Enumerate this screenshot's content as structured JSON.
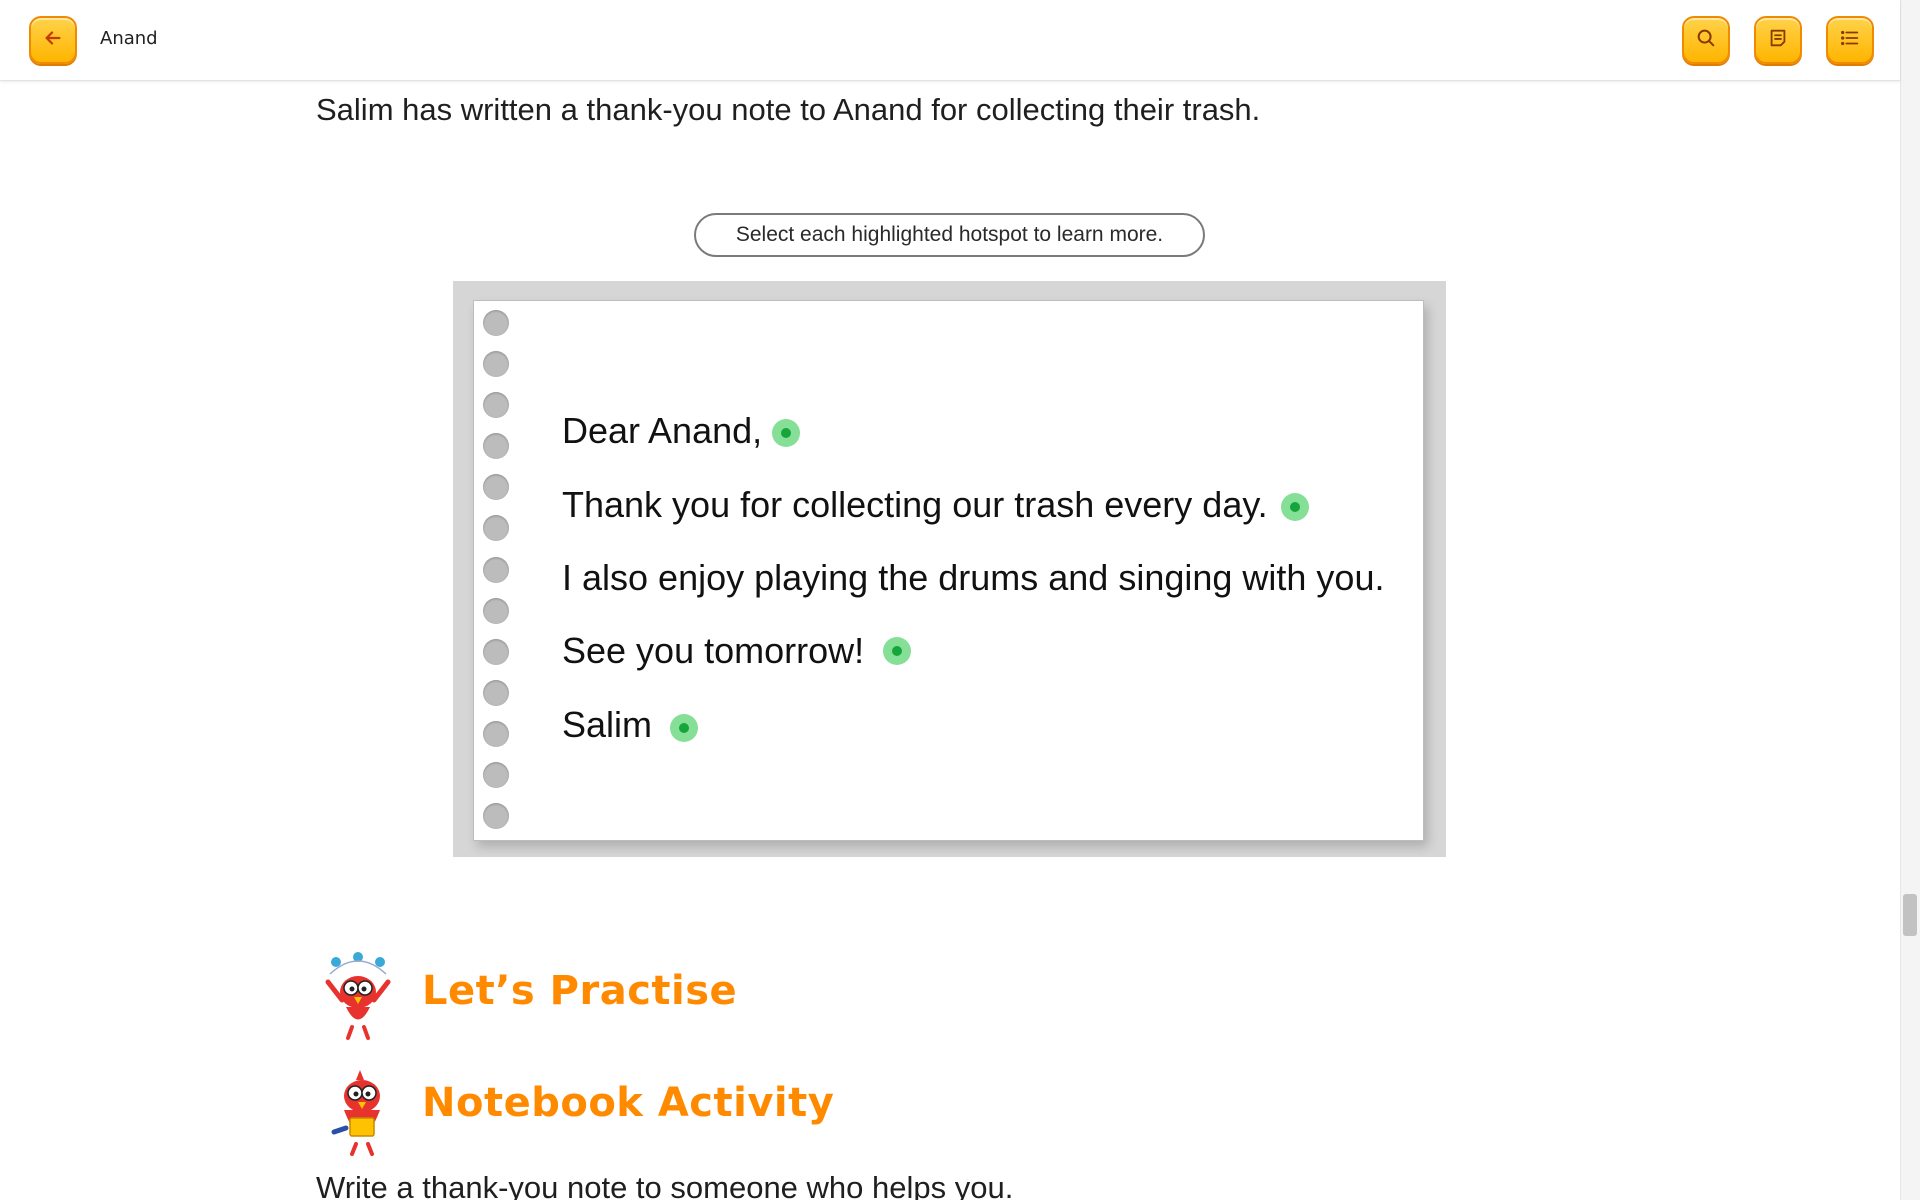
{
  "header": {
    "title": "Anand",
    "back_icon": "arrow-left-icon",
    "search_icon": "search-icon",
    "notes_icon": "notes-icon",
    "toc_icon": "list-icon"
  },
  "content": {
    "intro": "Salim has written a thank-you note to Anand for collecting their trash.",
    "hint": "Select each highlighted hotspot to learn more.",
    "note_lines": [
      "Dear Anand,",
      "Thank you for collecting our trash every day.",
      "I also enjoy playing the drums and singing with you.",
      "See you tomorrow!",
      "Salim"
    ],
    "practise_title": "Let’s Practise",
    "notebook_title": "Notebook Activity",
    "activity_text": "Write a thank-you note to someone who helps you."
  },
  "colors": {
    "accent": "#ff8a00",
    "button": "#ffb500",
    "hotspot": "#86df97"
  }
}
